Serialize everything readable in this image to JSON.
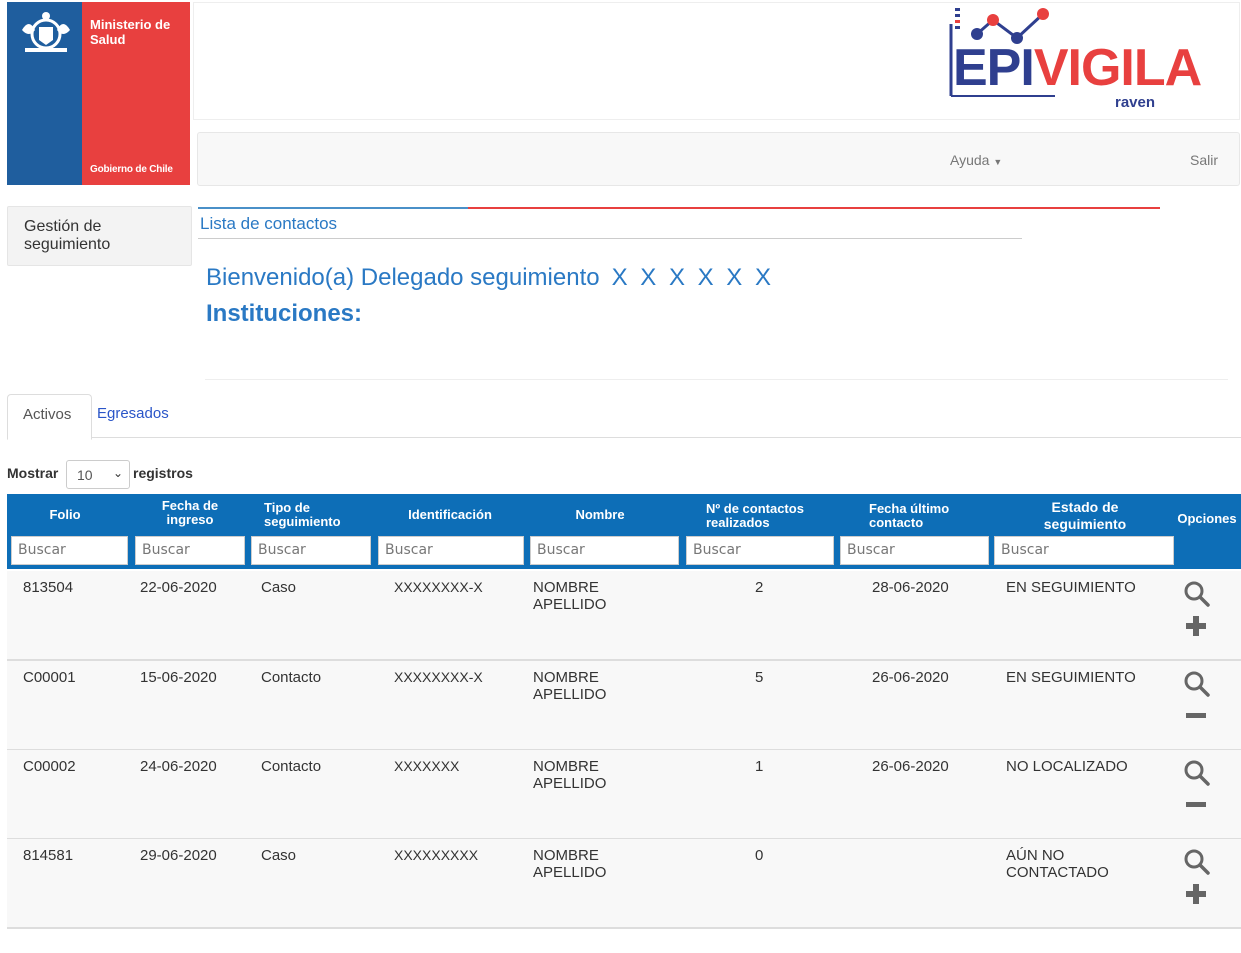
{
  "logo": {
    "ministry_line": "Ministerio de Salud",
    "government": "Gobierno de Chile",
    "app_name_part1": "EPI",
    "app_name_part2": "VIGILA",
    "partner": "raven"
  },
  "navbar": {
    "help": "Ayuda",
    "exit": "Salir"
  },
  "sidebar": {
    "button": "Gestión de seguimiento"
  },
  "main": {
    "list_title": "Lista de contactos",
    "welcome": "Bienvenido(a) Delegado seguimiento",
    "welcome_user": "X X X X X X",
    "institutions": "Instituciones:"
  },
  "tabs": {
    "active": "Activos",
    "discharged": "Egresados"
  },
  "table_controls": {
    "show": "Mostrar",
    "page_size": "10",
    "records": "registros"
  },
  "table": {
    "columns": [
      "Folio",
      "Fecha de ingreso",
      "Tipo de seguimiento",
      "Identificación",
      "Nombre",
      "Nº de contactos realizados",
      "Fecha último contacto",
      "Estado de seguimiento",
      "Opciones"
    ],
    "search_placeholder": "Buscar",
    "rows": [
      {
        "folio": "813504",
        "ingreso": "22-06-2020",
        "tipo": "Caso",
        "id": "XXXXXXXX-X",
        "nombre": "NOMBRE APELLIDO",
        "contactos": "2",
        "ultimo": "28-06-2020",
        "estado": "EN SEGUIMIENTO",
        "action": "plus"
      },
      {
        "folio": "C00001",
        "ingreso": "15-06-2020",
        "tipo": "Contacto",
        "id": "XXXXXXXX-X",
        "nombre": "NOMBRE APELLIDO",
        "contactos": "5",
        "ultimo": "26-06-2020",
        "estado": "EN SEGUIMIENTO",
        "action": "minus"
      },
      {
        "folio": "C00002",
        "ingreso": "24-06-2020",
        "tipo": "Contacto",
        "id": "XXXXXXX",
        "nombre": "NOMBRE APELLIDO",
        "contactos": "1",
        "ultimo": "26-06-2020",
        "estado": "NO LOCALIZADO",
        "action": "minus"
      },
      {
        "folio": "814581",
        "ingreso": "29-06-2020",
        "tipo": "Caso",
        "id": "XXXXXXXXX",
        "nombre": "NOMBRE APELLIDO",
        "contactos": "0",
        "ultimo": "",
        "estado": "AÚN NO CONTACTADO",
        "action": "plus"
      }
    ]
  },
  "colors": {
    "primary": "#0d6eb7",
    "link": "#2a79c4",
    "ministry_blue": "#1f5e9e",
    "ministry_red": "#e8403f"
  }
}
